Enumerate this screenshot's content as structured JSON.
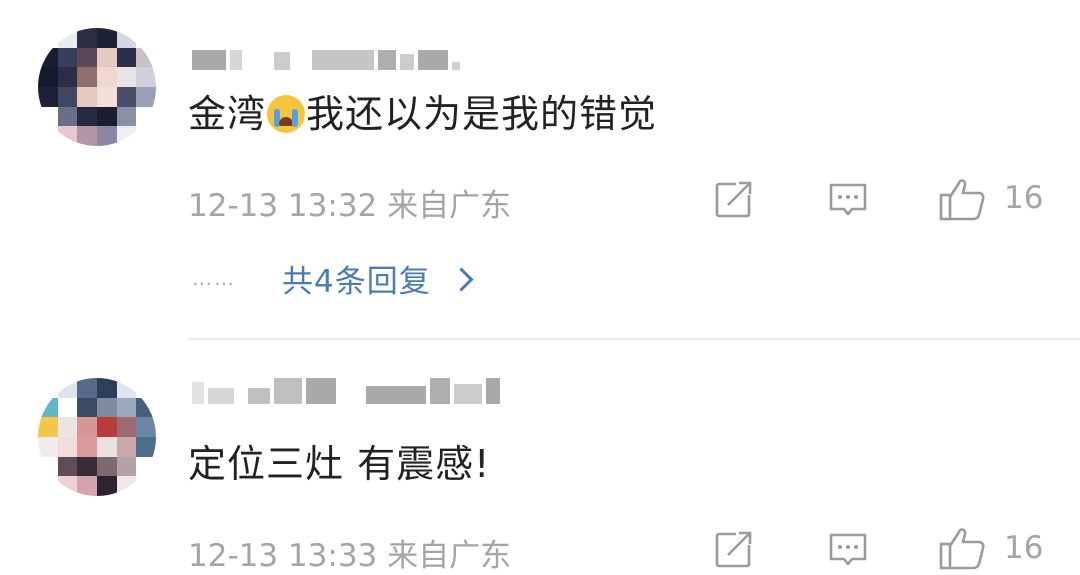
{
  "comments": [
    {
      "content_before": "金湾",
      "emoji": "crying-face-emoji",
      "content_after": "我还以为是我的错觉",
      "meta": "12-13 13:32  来自广东",
      "likes": "16",
      "replies_label": "共4条回复",
      "replies_dots": "……"
    },
    {
      "content": "定位三灶 有震感!",
      "meta": "12-13 13:33  来自广东",
      "likes": "16"
    }
  ],
  "icons": {
    "share": "share-icon",
    "comment": "comment-icon",
    "like": "thumbs-up-icon",
    "chevron": "chevron-right-icon"
  },
  "colors": {
    "text": "#222222",
    "meta": "#a5a5a5",
    "link": "#4a7bb5",
    "divider": "#ececec"
  }
}
